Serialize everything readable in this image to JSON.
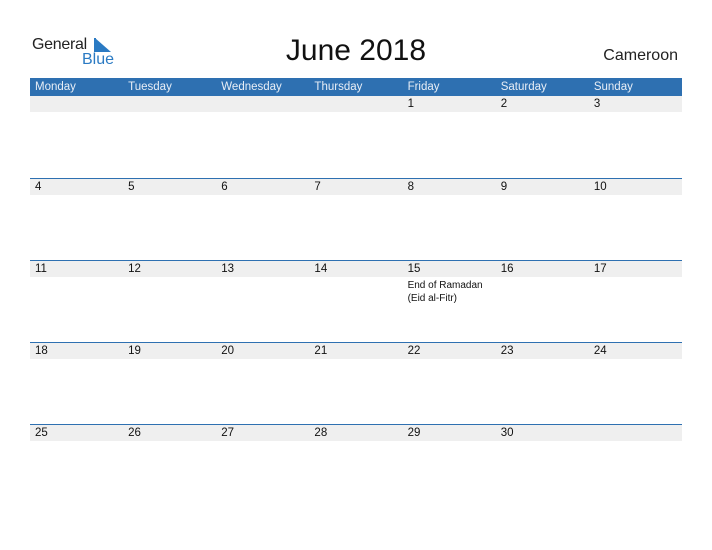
{
  "logo": {
    "word1": "General",
    "word2": "Blue"
  },
  "title": "June 2018",
  "country": "Cameroon",
  "colors": {
    "header_bg": "#2e70b1",
    "day_strip": "#efefef",
    "accent": "#2a7ac3"
  },
  "weekdays": [
    "Monday",
    "Tuesday",
    "Wednesday",
    "Thursday",
    "Friday",
    "Saturday",
    "Sunday"
  ],
  "weeks": [
    {
      "days": [
        "",
        "",
        "",
        "",
        "1",
        "2",
        "3"
      ],
      "events": [
        "",
        "",
        "",
        "",
        "",
        "",
        ""
      ]
    },
    {
      "days": [
        "4",
        "5",
        "6",
        "7",
        "8",
        "9",
        "10"
      ],
      "events": [
        "",
        "",
        "",
        "",
        "",
        "",
        ""
      ]
    },
    {
      "days": [
        "11",
        "12",
        "13",
        "14",
        "15",
        "16",
        "17"
      ],
      "events": [
        "",
        "",
        "",
        "",
        "End of Ramadan\n(Eid al-Fitr)",
        "",
        ""
      ]
    },
    {
      "days": [
        "18",
        "19",
        "20",
        "21",
        "22",
        "23",
        "24"
      ],
      "events": [
        "",
        "",
        "",
        "",
        "",
        "",
        ""
      ]
    },
    {
      "days": [
        "25",
        "26",
        "27",
        "28",
        "29",
        "30",
        ""
      ],
      "events": [
        "",
        "",
        "",
        "",
        "",
        "",
        ""
      ]
    }
  ]
}
